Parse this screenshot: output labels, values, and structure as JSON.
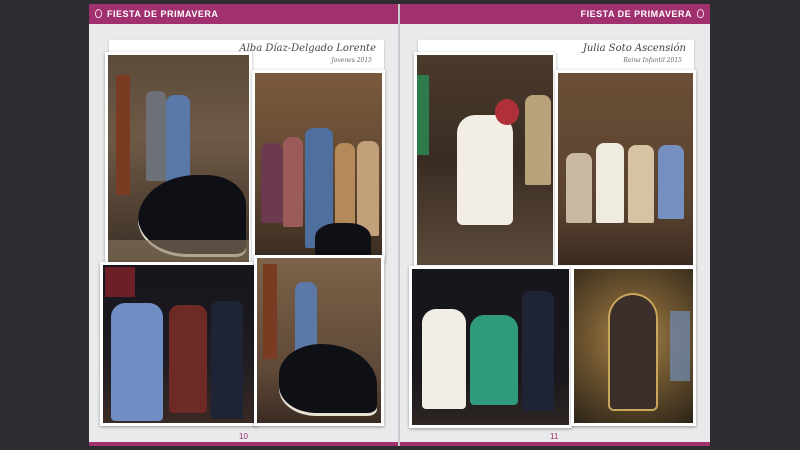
{
  "spread": {
    "left_page": {
      "header": "FIESTA DE PRIMAVERA",
      "name": "Alba Díaz-Delgado Lorente",
      "subtitle": "Jovenes 2015",
      "page_number": "10"
    },
    "right_page": {
      "header": "FIESTA DE PRIMAVERA",
      "name": "Julia Soto Ascensión",
      "subtitle": "Reina Infantil 2015",
      "page_number": "11"
    }
  },
  "colors": {
    "brand": "#a1316e",
    "page": "#e9eaec",
    "background": "#2b2d31"
  }
}
